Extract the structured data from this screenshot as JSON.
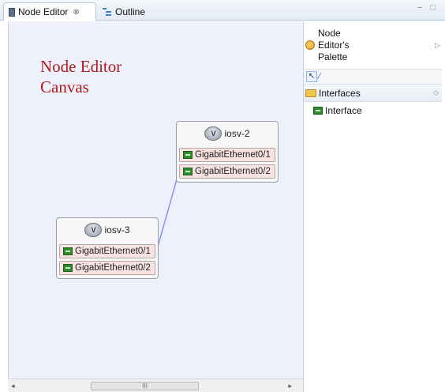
{
  "tabs": [
    {
      "label": "Node Editor",
      "close": "⊗",
      "active": true
    },
    {
      "label": "Outline",
      "active": false
    }
  ],
  "window_controls": {
    "minimize": "−",
    "maximize": "□"
  },
  "canvas": {
    "title": "Node Editor\nCanvas",
    "title_color": "#b11b1b",
    "background": "#eef0fb",
    "nodes": [
      {
        "name": "iosv-2",
        "interfaces": [
          "GigabitEthernet0/1",
          "GigabitEthernet0/2"
        ]
      },
      {
        "name": "iosv-3",
        "interfaces": [
          "GigabitEthernet0/1",
          "GigabitEthernet0/2"
        ]
      }
    ],
    "link": {
      "from": "iosv-2 GigabitEthernet0/2",
      "to": "iosv-3 GigabitEthernet0/1",
      "color": "#8f8ff0"
    }
  },
  "scrollbar": {
    "left_arrow": "◂",
    "right_arrow": "▸",
    "thumb_grip": "III"
  },
  "palette": {
    "title": "Node\nEditor's\nPalette",
    "menu_arrow": "▷",
    "tools": [
      {
        "icon": "select-arrow-icon",
        "glyph": "↖"
      },
      {
        "icon": "connection-tool-icon",
        "glyph": "∕"
      }
    ],
    "drawer": {
      "label": "Interfaces",
      "toggle": "◇"
    },
    "entries": [
      {
        "label": "Interface",
        "icon": "interface-icon"
      }
    ]
  }
}
